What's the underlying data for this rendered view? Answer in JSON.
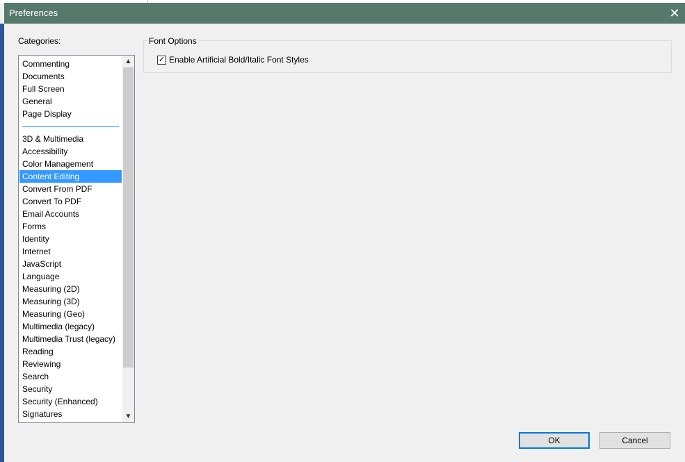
{
  "dialog": {
    "title": "Preferences",
    "close_icon": "close-icon"
  },
  "categories": {
    "label": "Categories:",
    "items": [
      {
        "label": "Commenting"
      },
      {
        "label": "Documents"
      },
      {
        "label": "Full Screen"
      },
      {
        "label": "General"
      },
      {
        "label": "Page Display"
      },
      {
        "separator": true
      },
      {
        "label": "3D & Multimedia"
      },
      {
        "label": "Accessibility"
      },
      {
        "label": "Color Management"
      },
      {
        "label": "Content Editing",
        "selected": true
      },
      {
        "label": "Convert From PDF"
      },
      {
        "label": "Convert To PDF"
      },
      {
        "label": "Email Accounts"
      },
      {
        "label": "Forms"
      },
      {
        "label": "Identity"
      },
      {
        "label": "Internet"
      },
      {
        "label": "JavaScript"
      },
      {
        "label": "Language"
      },
      {
        "label": "Measuring (2D)"
      },
      {
        "label": "Measuring (3D)"
      },
      {
        "label": "Measuring (Geo)"
      },
      {
        "label": "Multimedia (legacy)"
      },
      {
        "label": "Multimedia Trust (legacy)"
      },
      {
        "label": "Reading"
      },
      {
        "label": "Reviewing"
      },
      {
        "label": "Search"
      },
      {
        "label": "Security"
      },
      {
        "label": "Security (Enhanced)"
      },
      {
        "label": "Signatures"
      }
    ]
  },
  "font_options": {
    "legend": "Font Options",
    "enable_artificial": {
      "label": "Enable Artificial Bold/Italic Font Styles",
      "checked": true
    }
  },
  "buttons": {
    "ok": "OK",
    "cancel": "Cancel"
  },
  "colors": {
    "titlebar": "#557a6c",
    "selection": "#3399ff",
    "ok_border": "#0078d7"
  }
}
